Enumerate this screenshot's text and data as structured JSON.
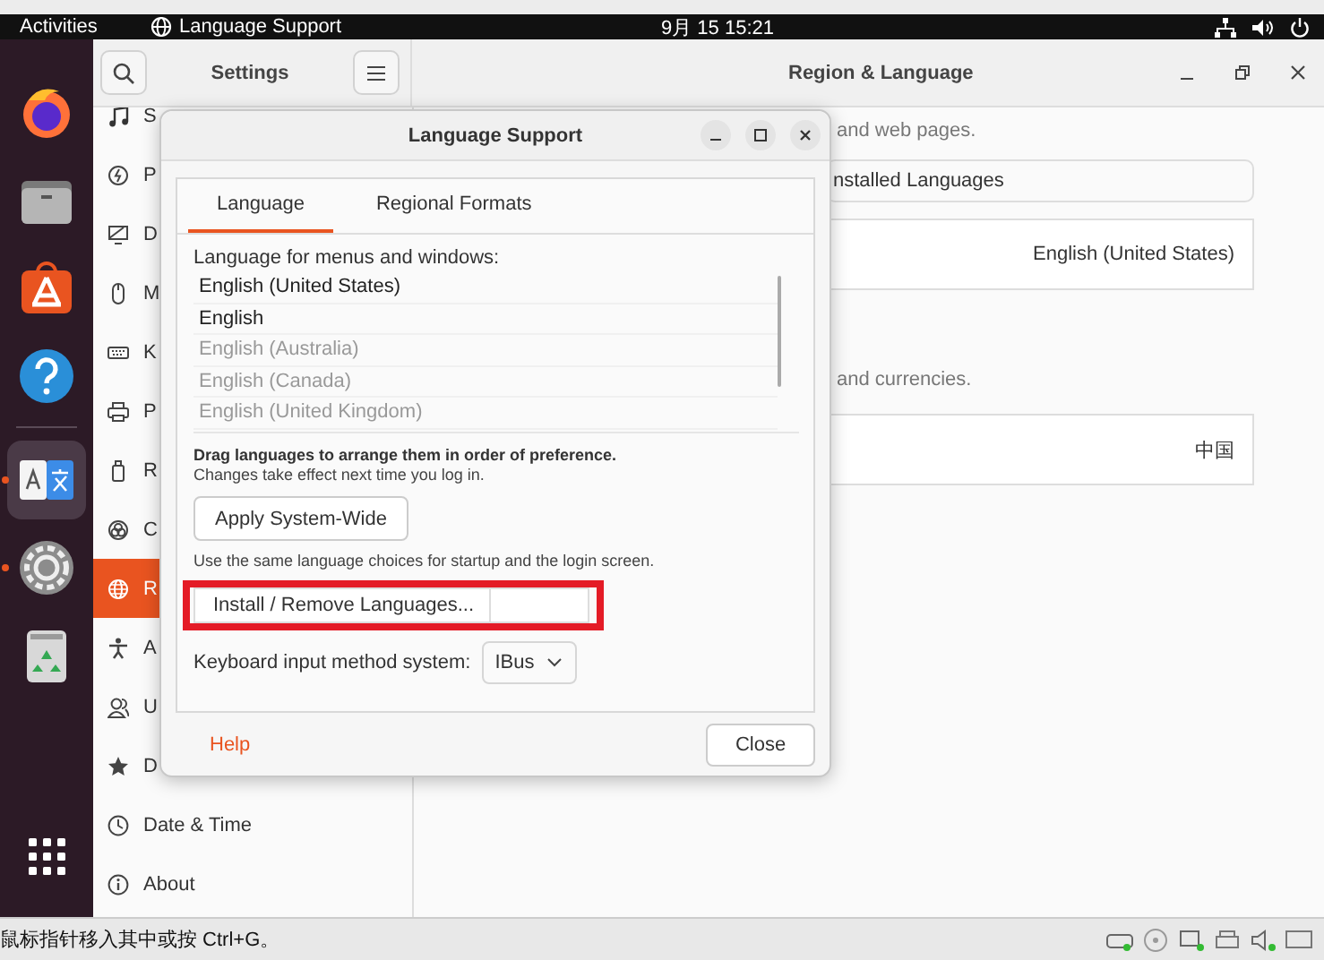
{
  "top_bar": {
    "activities": "Activities",
    "app_name": "Language Support",
    "clock": "9月 15  15:21"
  },
  "dock": {
    "items": [
      {
        "kind": "firefox",
        "running": false
      },
      {
        "kind": "files",
        "running": false
      },
      {
        "kind": "store",
        "running": false
      },
      {
        "kind": "help",
        "running": false
      },
      {
        "kind": "language",
        "running": true
      },
      {
        "kind": "settings",
        "running": true
      },
      {
        "kind": "trash",
        "running": false
      }
    ]
  },
  "settings": {
    "sidebar_title": "Settings",
    "title": "Region & Language",
    "sidebar_items": [
      {
        "label": "S",
        "selected": false
      },
      {
        "label": "P",
        "selected": false
      },
      {
        "label": "D",
        "selected": false
      },
      {
        "label": "M",
        "selected": false
      },
      {
        "label": "K",
        "selected": false
      },
      {
        "label": "P",
        "selected": false
      },
      {
        "label": "R",
        "selected": false
      },
      {
        "label": "C",
        "selected": false
      },
      {
        "label": "R",
        "selected": true
      },
      {
        "label": "A",
        "selected": false
      },
      {
        "label": "U",
        "selected": false
      },
      {
        "label": "D",
        "selected": false
      },
      {
        "label": "Date & Time",
        "selected": false
      },
      {
        "label": "About",
        "selected": false
      }
    ],
    "language_note": "and web pages.",
    "manage_button": "nstalled Languages",
    "language_value": "English (United States)",
    "formats_note": "and currencies.",
    "formats_value": "中国"
  },
  "dialog": {
    "title": "Language Support",
    "tabs": [
      {
        "label": "Language",
        "selected": true
      },
      {
        "label": "Regional Formats",
        "selected": false
      }
    ],
    "list_label": "Language for menus and windows:",
    "languages": [
      "English (United States)",
      "English"
    ],
    "unused_languages": [
      "English (Australia)",
      "English (Canada)",
      "English (United Kingdom)"
    ],
    "drag_hint": "Drag languages to arrange them in order of preference.",
    "drag_note": "Changes take effect next time you log in.",
    "apply_button": "Apply System-Wide",
    "apply_note": "Use the same language choices for startup and the login screen.",
    "install_button": "Install / Remove Languages...",
    "install_highlighted": true,
    "input_label": "Keyboard input method system:",
    "input_value": "IBus",
    "help": "Help",
    "close": "Close"
  },
  "status_bar": {
    "hint": "鼠标指针移入其中或按 Ctrl+G。"
  }
}
